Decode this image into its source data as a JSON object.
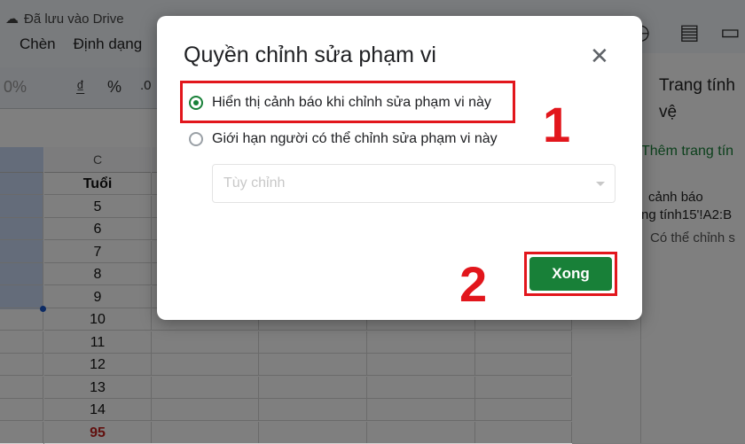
{
  "app": {
    "save_status": "Đã lưu vào Drive",
    "menu": [
      "Chèn",
      "Định dạng"
    ],
    "toolbar": {
      "zoom": "0%",
      "currency": "₫",
      "percent": "%",
      "decimal": ".0"
    }
  },
  "sheet": {
    "column_label": "C",
    "header": "Tuổi",
    "values": [
      "5",
      "6",
      "7",
      "8",
      "9",
      "10",
      "11",
      "12",
      "13",
      "14",
      "95"
    ],
    "highlight_color": "#c5221f"
  },
  "side_panel": {
    "title": "Trang tính và dải ô được bảo vệ",
    "title_visible": "Trang tính\nvệ",
    "add_link": "Thêm trang tín",
    "warn_line1": "cảnh báo",
    "warn_line2": "ng tính15'!A2:B",
    "warn_line3": "Có thể chỉnh s"
  },
  "dialog": {
    "title": "Quyền chỉnh sửa phạm vi",
    "option_warning": "Hiển thị cảnh báo khi chỉnh sửa phạm vi này",
    "option_restrict": "Giới hạn người có thể chỉnh sửa phạm vi này",
    "select_placeholder": "Tùy chỉnh",
    "done_button": "Xong",
    "step1": "1",
    "step2": "2"
  },
  "colors": {
    "accent": "#188038",
    "annotation": "#e2161c"
  }
}
